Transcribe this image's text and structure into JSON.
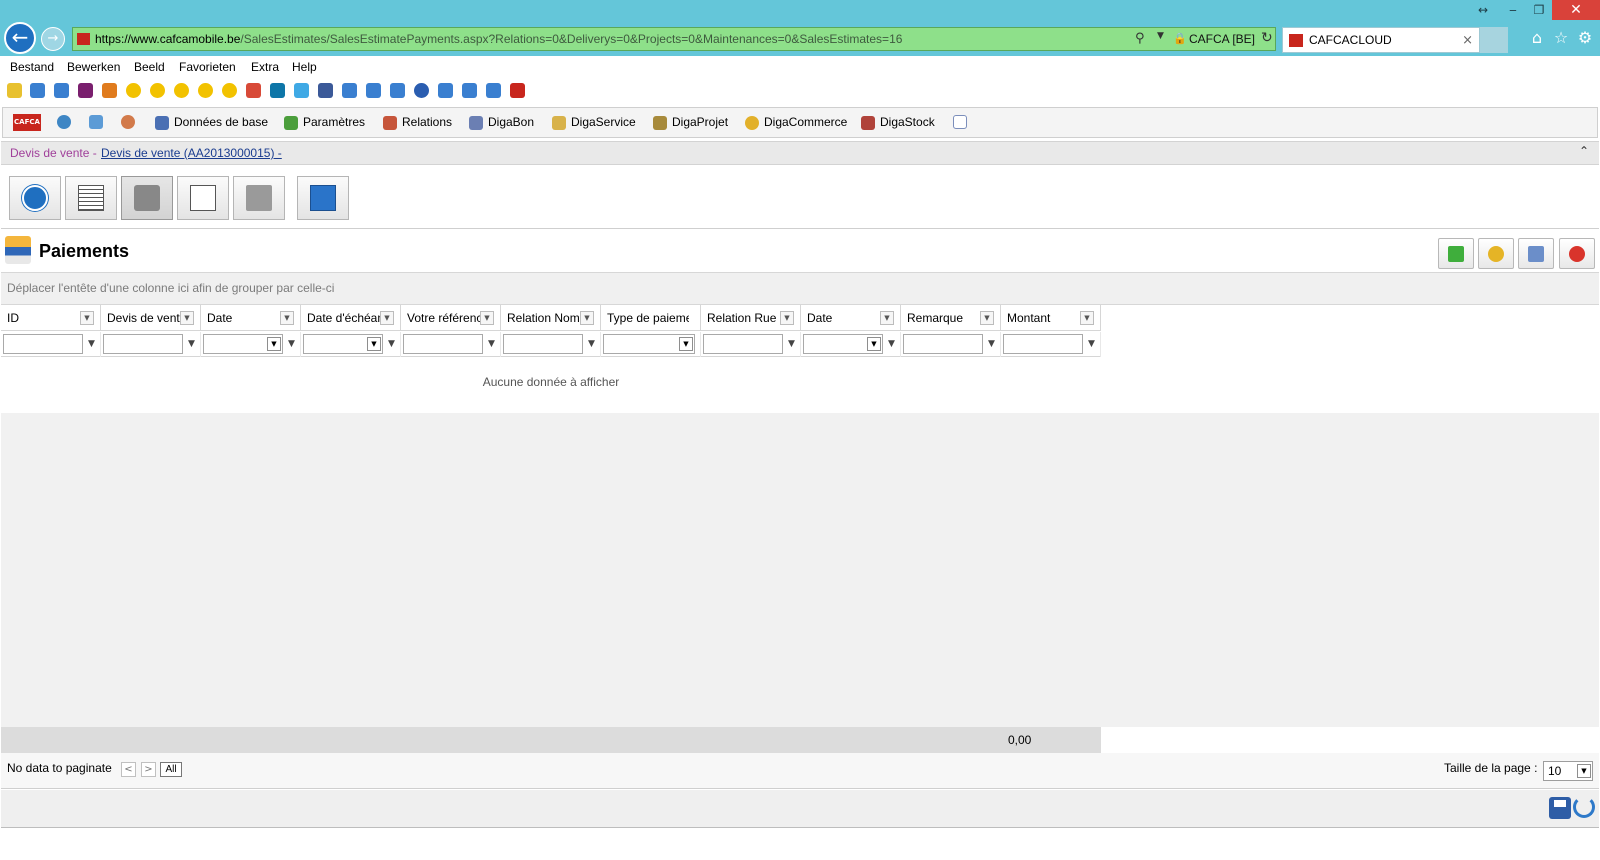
{
  "browser": {
    "url_host_prefix": "https://www.",
    "url_host": "cafcamobile.be",
    "url_path": "/SalesEstimates/SalesEstimatePayments.aspx?Relations=0&Deliverys=0&Projects=0&Maintenances=0&SalesEstimates=16",
    "site_identity": "CAFCA [BE]",
    "tab_title": "CAFCACLOUD",
    "tab_close": "×"
  },
  "menu": [
    "Bestand",
    "Bewerken",
    "Beeld",
    "Favorieten",
    "Extra",
    "Help"
  ],
  "app_nav": {
    "logo_text": "CAFCA",
    "items": [
      {
        "label": "Données de base",
        "icon": "database-icon",
        "color": "#4a6fb3"
      },
      {
        "label": "Paramètres",
        "icon": "gears-icon",
        "color": "#4b9e3c"
      },
      {
        "label": "Relations",
        "icon": "people-icon",
        "color": "#c6553a"
      },
      {
        "label": "DigaBon",
        "icon": "document-icon",
        "color": "#6b7fb3"
      },
      {
        "label": "DigaService",
        "icon": "folder-icon",
        "color": "#d8b24a"
      },
      {
        "label": "DigaProjet",
        "icon": "pushpin-icon",
        "color": "#a78a3b"
      },
      {
        "label": "DigaCommerce",
        "icon": "coin-icon",
        "color": "#e2b02a"
      },
      {
        "label": "DigaStock",
        "icon": "truck-icon",
        "color": "#b0433a"
      }
    ]
  },
  "breadcrumb": {
    "part1": "Devis de vente -",
    "part2": "Devis de vente (AA2013000015) -"
  },
  "section": {
    "title": "Paiements"
  },
  "grid": {
    "group_hint": "Déplacer l'entête d'une colonne ici afin de grouper par celle-ci",
    "columns": [
      "ID",
      "Devis de vente",
      "Date",
      "Date d'échéance",
      "Votre référence",
      "Relation Nom",
      "Type de paiement",
      "Relation Rue",
      "Date",
      "Remarque",
      "Montant"
    ],
    "empty_text": "Aucune donnée à afficher",
    "footer_total": "0,00"
  },
  "pager": {
    "status": "No data to paginate",
    "prev": "<",
    "next": ">",
    "all_label": "All",
    "page_size_label": "Taille de la page :",
    "page_size_value": "10"
  },
  "colors": {
    "chrome": "#64c6d9",
    "address_bar": "#8ee08a",
    "breadcrumb_first": "#a0409a",
    "breadcrumb_link": "#1a3c8f",
    "brand_red": "#c8261d"
  }
}
